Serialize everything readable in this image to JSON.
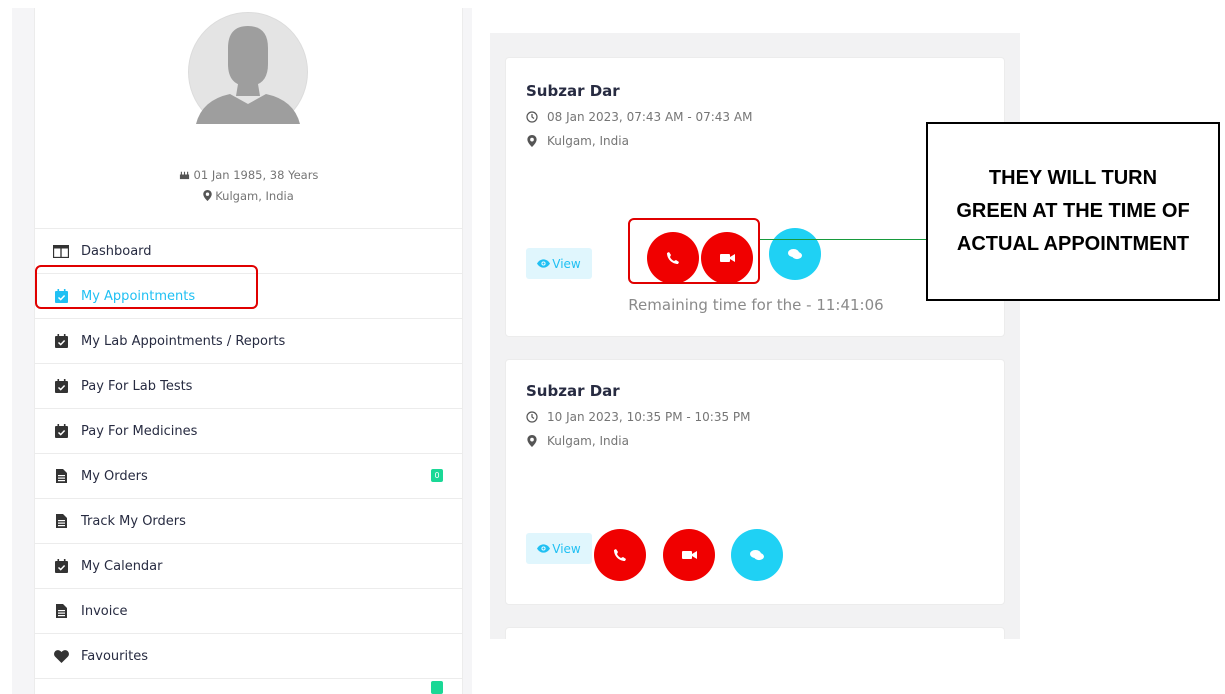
{
  "profile": {
    "dob": "01 Jan 1985, 38 Years",
    "location": "Kulgam, India"
  },
  "sidebar": {
    "items": [
      {
        "label": "Dashboard",
        "icon": "columns-icon"
      },
      {
        "label": "My Appointments",
        "icon": "calendar-check-icon",
        "active": true
      },
      {
        "label": "My Lab Appointments / Reports",
        "icon": "calendar-check-icon"
      },
      {
        "label": "Pay For Lab Tests",
        "icon": "calendar-check-icon"
      },
      {
        "label": "Pay For Medicines",
        "icon": "calendar-check-icon"
      },
      {
        "label": "My Orders",
        "icon": "file-icon",
        "badge": "0"
      },
      {
        "label": "Track My Orders",
        "icon": "file-icon"
      },
      {
        "label": "My Calendar",
        "icon": "calendar-check-icon"
      },
      {
        "label": "Invoice",
        "icon": "file-icon"
      },
      {
        "label": "Favourites",
        "icon": "heart-icon"
      }
    ]
  },
  "appointments": [
    {
      "name": "Subzar Dar",
      "datetime": "08 Jan 2023, 07:43 AM - 07:43 AM",
      "location": "Kulgam, India",
      "view_label": "View",
      "remaining": "Remaining time for the - 11:41:06"
    },
    {
      "name": "Subzar Dar",
      "datetime": "10 Jan 2023, 10:35 PM - 10:35 PM",
      "location": "Kulgam, India",
      "view_label": "View"
    }
  ],
  "annotation": {
    "text": "THEY WILL TURN GREEN AT THE TIME OF ACTUAL APPOINTMENT"
  },
  "colors": {
    "accent": "#20c0f3",
    "call_red": "#f00000",
    "chat_cyan": "#1fd1f4",
    "badge_green": "#1ad896",
    "highlight_red": "#e00000",
    "connector_green": "#179a3c"
  }
}
